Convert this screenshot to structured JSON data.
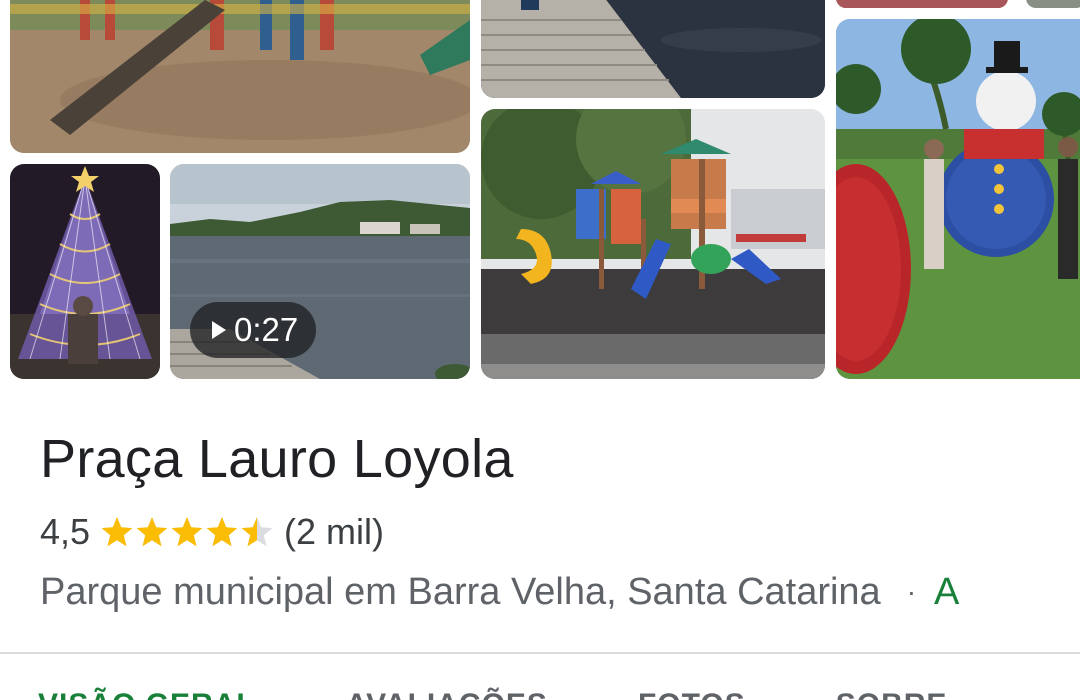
{
  "gallery": {
    "video_duration": "0:27"
  },
  "place": {
    "name": "Praça Lauro Loyola",
    "rating": 4.5,
    "rating_text": "4,5",
    "review_count": "(2 mil)",
    "category": "Parque municipal em Barra Velha, Santa Catarina",
    "separator": "·",
    "status_partial": "A"
  },
  "tabs": [
    "VISÃO GERAL",
    "AVALIAÇÕES",
    "FOTOS",
    "SOBRE"
  ],
  "colors": {
    "star": "#fbbc04",
    "star_empty": "#dadce0",
    "title": "#202124",
    "secondary_text": "#5f6368",
    "accent_green": "#188038",
    "divider": "#dadce0"
  },
  "icons": [
    "play-icon",
    "star-icon",
    "star-half-icon"
  ]
}
